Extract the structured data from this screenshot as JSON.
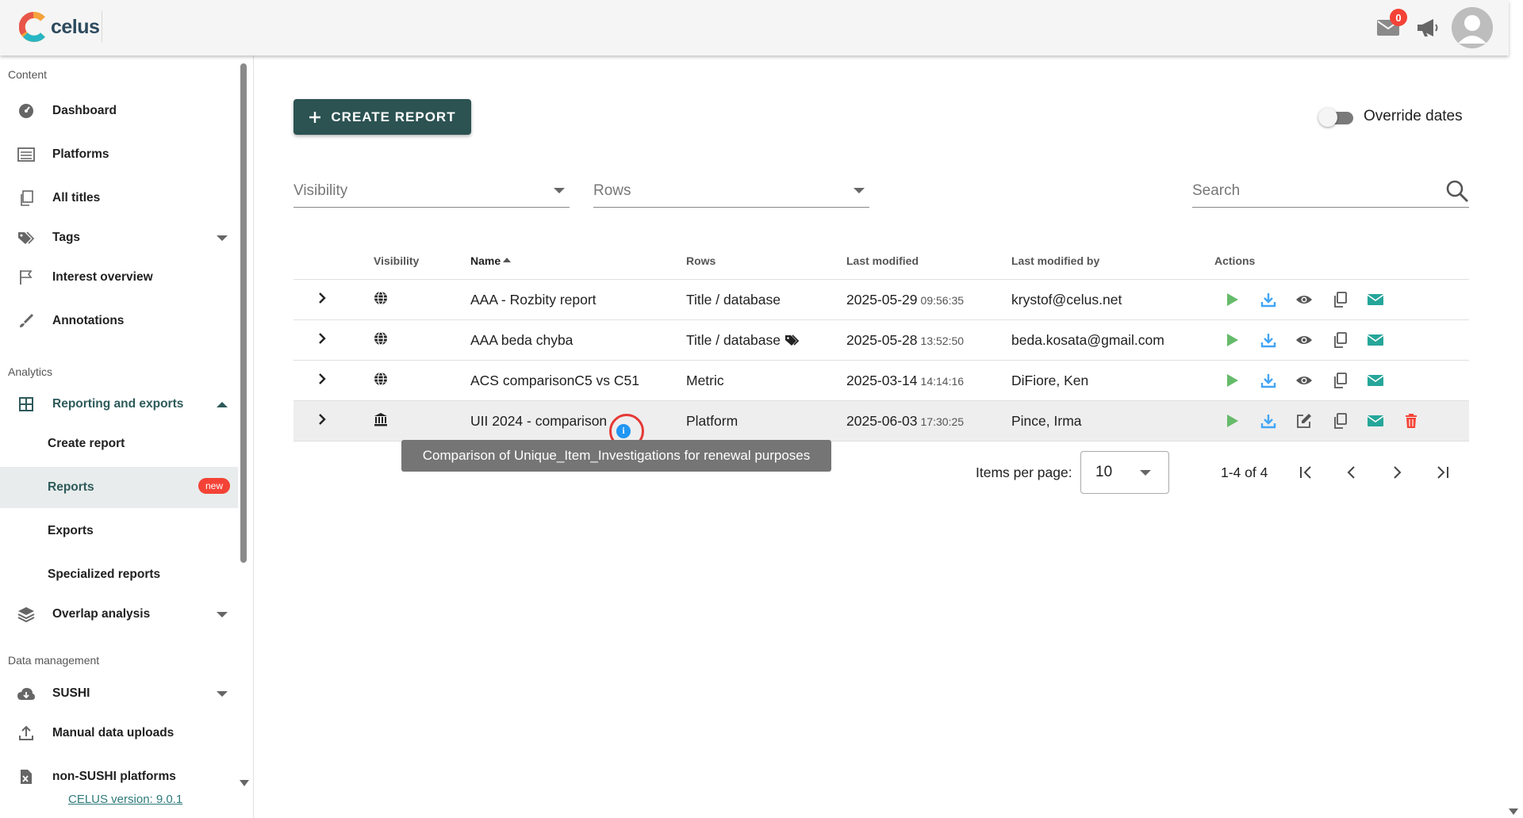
{
  "app": {
    "logo_text": "celus",
    "mail_count": "0"
  },
  "sidebar": {
    "sections": {
      "content": "Content",
      "analytics": "Analytics",
      "data_management": "Data management"
    },
    "items": {
      "dashboard": "Dashboard",
      "platforms": "Platforms",
      "all_titles": "All titles",
      "tags": "Tags",
      "interest_overview": "Interest overview",
      "annotations": "Annotations",
      "reporting": "Reporting and exports",
      "create_report": "Create report",
      "reports": "Reports",
      "reports_badge": "new",
      "exports": "Exports",
      "specialized_reports": "Specialized reports",
      "overlap": "Overlap analysis",
      "sushi": "SUSHI",
      "manual_uploads": "Manual data uploads",
      "non_sushi": "non-SUSHI platforms"
    },
    "version": "CELUS version: 9.0.1"
  },
  "toolbar": {
    "create_label": "CREATE REPORT",
    "override_label": "Override dates",
    "override_on": false
  },
  "filters": {
    "visibility_placeholder": "Visibility",
    "rows_placeholder": "Rows",
    "search_placeholder": "Search"
  },
  "table": {
    "headers": {
      "visibility": "Visibility",
      "name": "Name",
      "rows": "Rows",
      "last_modified": "Last modified",
      "last_modified_by": "Last modified by",
      "actions": "Actions"
    },
    "rows": [
      {
        "visibility_icon": "globe-icon",
        "name": "AAA - Rozbity report",
        "rows": "Title / database",
        "date": "2025-05-29",
        "time": "09:56:35",
        "by": "krystof@celus.net"
      },
      {
        "visibility_icon": "globe-icon",
        "name": "AAA beda chyba",
        "rows": "Title / database",
        "date": "2025-05-28",
        "time": "13:52:50",
        "by": "beda.kosata@gmail.com"
      },
      {
        "visibility_icon": "globe-icon",
        "name": "ACS comparisonC5 vs C51",
        "rows": "Metric",
        "date": "2025-03-14",
        "time": "14:14:16",
        "by": "DiFiore, Ken"
      },
      {
        "visibility_icon": "bank-icon",
        "name": "UII 2024 - comparison",
        "rows": "Platform",
        "date": "2025-06-03",
        "time": "17:30:25",
        "by": "Pince, Irma"
      }
    ],
    "tooltip": "Comparison of Unique_Item_Investigations for renewal purposes",
    "info_glyph": "i"
  },
  "pagination": {
    "items_per_page_label": "Items per page:",
    "items_per_page": "10",
    "range": "1-4 of 4"
  },
  "colors": {
    "primary": "#2c5252",
    "play": "#66bb6a",
    "download": "#42a5f5",
    "mail": "#26a69a",
    "delete": "#f44336",
    "badge": "#f44336"
  }
}
